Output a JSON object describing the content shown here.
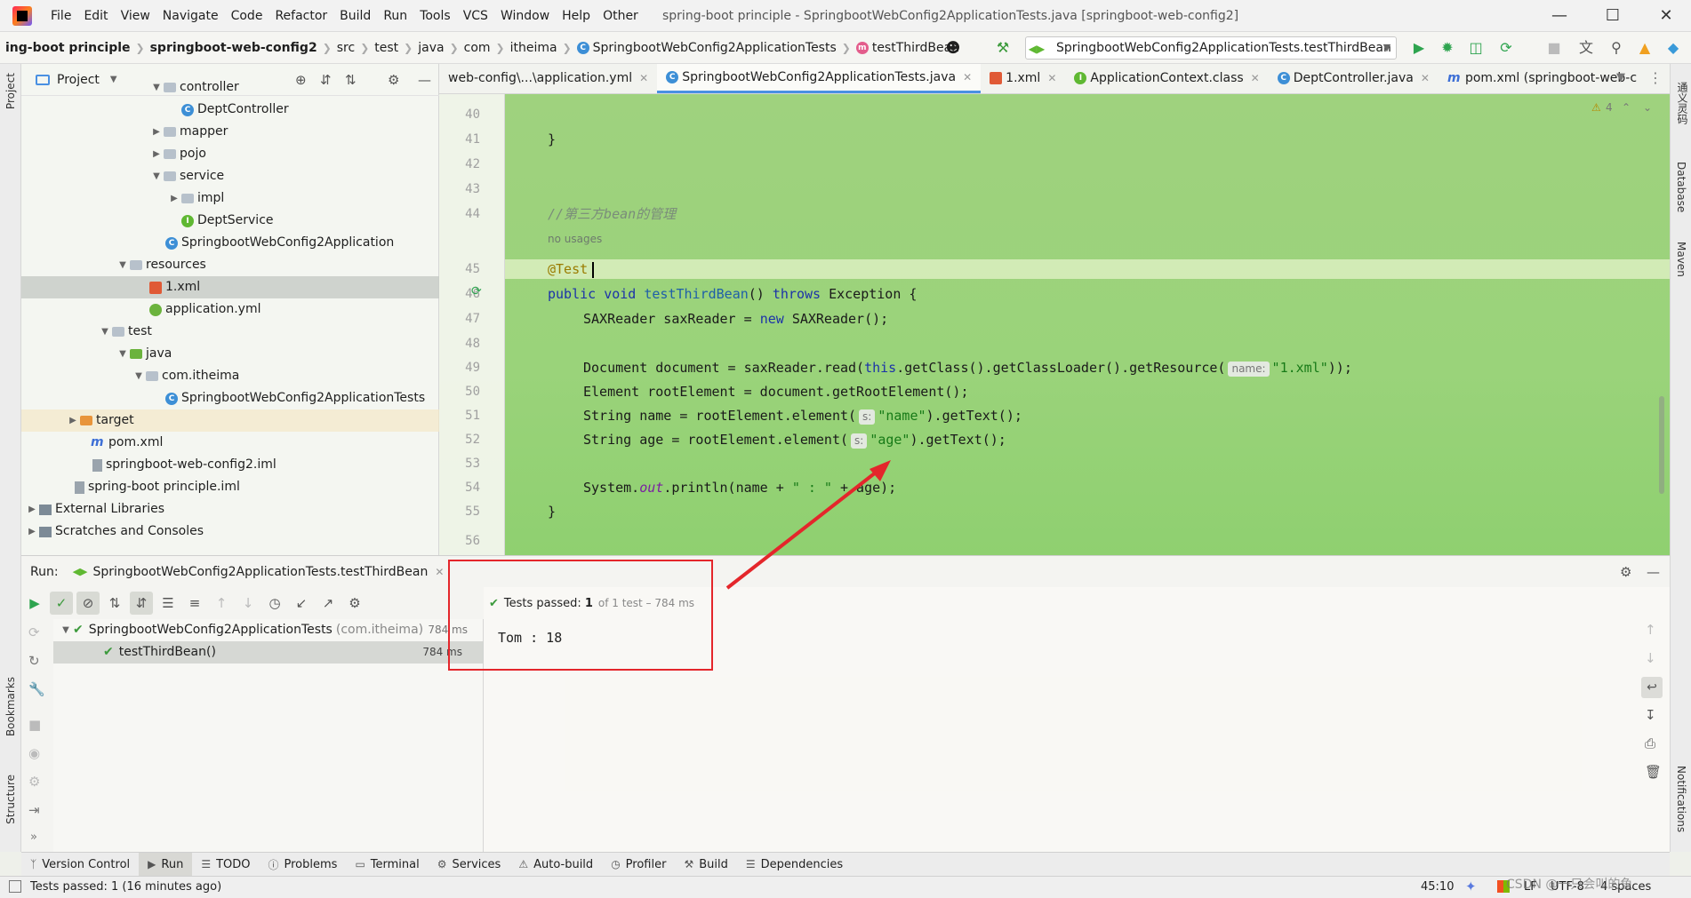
{
  "menu": {
    "items": [
      "File",
      "Edit",
      "View",
      "Navigate",
      "Code",
      "Refactor",
      "Build",
      "Run",
      "Tools",
      "VCS",
      "Window",
      "Help",
      "Other"
    ],
    "window_title": "spring-boot principle - SpringbootWebConfig2ApplicationTests.java [springboot-web-config2]"
  },
  "breadcrumbs": [
    "ing-boot principle",
    "springboot-web-config2",
    "src",
    "test",
    "java",
    "com",
    "itheima",
    "SpringbootWebConfig2ApplicationTests",
    "testThirdBean"
  ],
  "run_config": "SpringbootWebConfig2ApplicationTests.testThirdBean",
  "project_panel": {
    "title": "Project",
    "tree": [
      {
        "label": "controller",
        "type": "folder",
        "expanded": true
      },
      {
        "label": "DeptController",
        "type": "class"
      },
      {
        "label": "mapper",
        "type": "folder",
        "expanded": false
      },
      {
        "label": "pojo",
        "type": "folder",
        "expanded": false
      },
      {
        "label": "service",
        "type": "folder",
        "expanded": true
      },
      {
        "label": "impl",
        "type": "folder",
        "expanded": false
      },
      {
        "label": "DeptService",
        "type": "interface"
      },
      {
        "label": "SpringbootWebConfig2Application",
        "type": "class"
      },
      {
        "label": "resources",
        "type": "folder",
        "expanded": true
      },
      {
        "label": "1.xml",
        "type": "xml",
        "selected": true
      },
      {
        "label": "application.yml",
        "type": "yml"
      },
      {
        "label": "test",
        "type": "folder",
        "expanded": true
      },
      {
        "label": "java",
        "type": "folder",
        "expanded": true
      },
      {
        "label": "com.itheima",
        "type": "folder",
        "expanded": true
      },
      {
        "label": "SpringbootWebConfig2ApplicationTests",
        "type": "class"
      },
      {
        "label": "target",
        "type": "folder",
        "expanded": false
      },
      {
        "label": "pom.xml",
        "type": "maven"
      },
      {
        "label": "springboot-web-config2.iml",
        "type": "iml"
      },
      {
        "label": "spring-boot principle.iml",
        "type": "iml"
      },
      {
        "label": "External Libraries",
        "type": "lib"
      },
      {
        "label": "Scratches and Consoles",
        "type": "lib"
      }
    ]
  },
  "editor_tabs": [
    {
      "label": "web-config\\...\\application.yml",
      "icon": "yml-icon",
      "active": false
    },
    {
      "label": "SpringbootWebConfig2ApplicationTests.java",
      "icon": "class-icon",
      "active": true
    },
    {
      "label": "1.xml",
      "icon": "xml-icon",
      "active": false
    },
    {
      "label": "ApplicationContext.class",
      "icon": "interface-icon",
      "active": false
    },
    {
      "label": "DeptController.java",
      "icon": "class-icon",
      "active": false
    },
    {
      "label": "pom.xml (springboot-web-c",
      "icon": "maven-icon",
      "active": false
    }
  ],
  "editor": {
    "warning_count": "4",
    "line_numbers": [
      "40",
      "41",
      "42",
      "43",
      "44",
      "45",
      "46",
      "47",
      "48",
      "49",
      "50",
      "51",
      "52",
      "53",
      "54",
      "55",
      "56"
    ],
    "code": {
      "l41": "}",
      "l44": "//第三方bean的管理",
      "no_usages": "no usages",
      "l45": "@Test",
      "l46_kw1": "public void ",
      "l46_name": "testThirdBean",
      "l46_rest": "() ",
      "l46_kw2": "throws ",
      "l46_tail": "Exception {",
      "l47_a": "SAXReader saxReader = ",
      "l47_kw": "new ",
      "l47_b": "SAXReader();",
      "l49_a": "Document document = saxReader.read(",
      "l49_kw": "this",
      "l49_b": ".getClass().getClassLoader().getResource(",
      "l49_hint": "name:",
      "l49_str": "\"1.xml\"",
      "l49_c": "));",
      "l50": "Element rootElement = document.getRootElement();",
      "l51_a": "String name = rootElement.element(",
      "l51_hint": "s:",
      "l51_str": "\"name\"",
      "l51_b": ").getText();",
      "l52_a": "String age = rootElement.element(",
      "l52_hint": "s:",
      "l52_str": "\"age\"",
      "l52_b": ").getText();",
      "l54_a": "System.",
      "l54_fld": "out",
      "l54_b": ".println(name + ",
      "l54_str": "\" : \"",
      "l54_c": " + age);",
      "l55": "}"
    }
  },
  "run_panel": {
    "label": "Run:",
    "tab": "SpringbootWebConfig2ApplicationTests.testThirdBean",
    "tests_passed_label": "Tests passed:",
    "tests_passed_count": "1",
    "tests_passed_detail": "of 1 test – 784 ms",
    "test_suite": "SpringbootWebConfig2ApplicationTests",
    "test_suite_pkg": "(com.itheima)",
    "test_suite_time": "784 ms",
    "test_case": "testThirdBean()",
    "test_case_time": "784 ms",
    "console_output": "Tom : 18"
  },
  "right_tools": [
    "通义灵码",
    "Database",
    "Maven",
    "Notifications"
  ],
  "left_tools": [
    "Project",
    "Bookmarks",
    "Structure"
  ],
  "tool_tabs": [
    "Version Control",
    "Run",
    "TODO",
    "Problems",
    "Terminal",
    "Services",
    "Auto-build",
    "Profiler",
    "Build",
    "Dependencies"
  ],
  "status": {
    "message": "Tests passed: 1 (16 minutes ago)",
    "position": "45:10",
    "line_sep": "LF",
    "encoding": "UTF-8",
    "indent": "4 spaces",
    "watermark": "CSDN @一只会叫的鱼"
  },
  "colors": {
    "accent": "#4a90e2",
    "annotation_box": "#e4262b",
    "pass_green": "#3c9a3c",
    "editor_bg": "#9ad37a"
  }
}
